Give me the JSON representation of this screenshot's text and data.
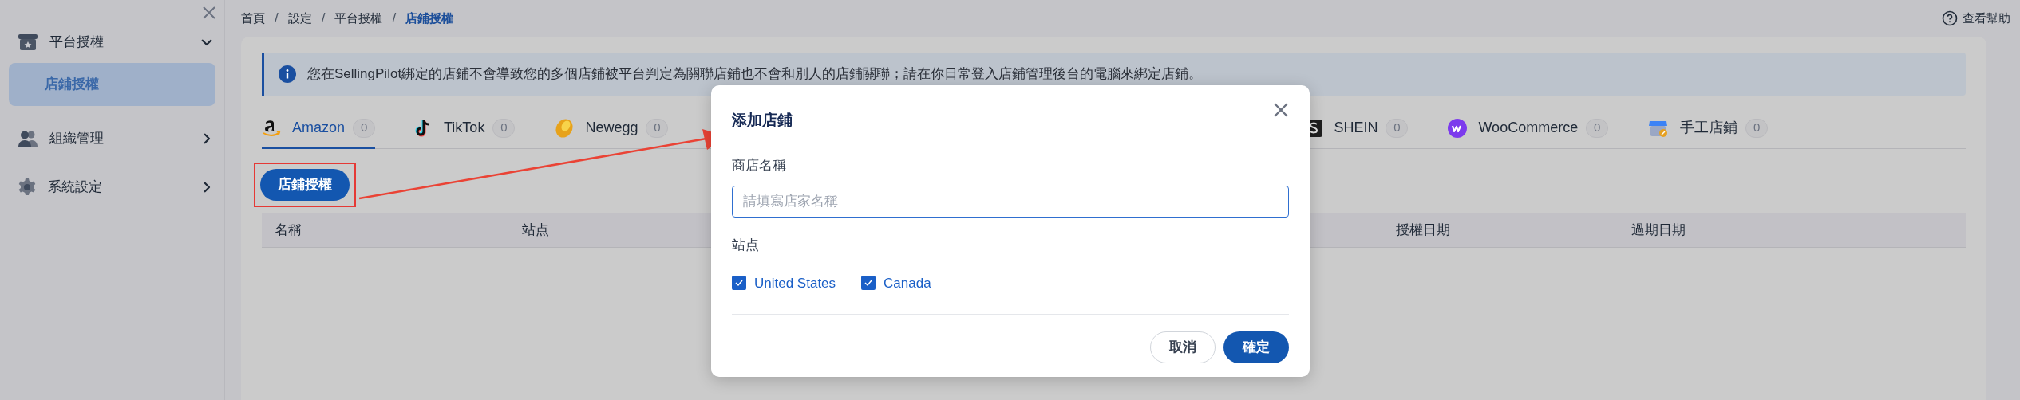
{
  "sidebar": {
    "items": [
      {
        "label": "平台授權",
        "kind": "store",
        "expanded": true,
        "children": [
          {
            "label": "店鋪授權",
            "selected": true
          }
        ]
      },
      {
        "label": "組織管理",
        "kind": "people",
        "expanded": false
      },
      {
        "label": "系統設定",
        "kind": "gear",
        "expanded": false
      }
    ]
  },
  "breadcrumb": [
    {
      "kind": "link",
      "label": "首頁",
      "selected": false
    },
    {
      "kind": "separator",
      "label": "/"
    },
    {
      "kind": "link",
      "label": "設定",
      "selected": false
    },
    {
      "kind": "separator",
      "label": "/"
    },
    {
      "kind": "link",
      "label": "平台授權",
      "selected": false
    },
    {
      "kind": "separator",
      "label": "/"
    },
    {
      "kind": "link",
      "label": "店鋪授權",
      "selected": true
    }
  ],
  "help_link": "查看幫助",
  "notice": "您在SellingPilot綁定的店鋪不會導致您的多個店鋪被平台判定為關聯店鋪也不會和別人的店鋪關聯；請在你日常登入店鋪管理後台的電腦來綁定店鋪。",
  "tabs": [
    {
      "label": "Amazon",
      "count": "0",
      "kind": "amazon",
      "selected": true
    },
    {
      "label": "TikTok",
      "count": "0",
      "kind": "tiktok",
      "selected": false
    },
    {
      "label": "Newegg",
      "count": "0",
      "kind": "egg",
      "selected": false
    },
    {
      "label": "SHEIN",
      "count": "0",
      "kind": "square",
      "selected": false
    },
    {
      "label": "WooCommerce",
      "count": "0",
      "kind": "woo",
      "selected": false
    },
    {
      "label": "手工店鋪",
      "count": "0",
      "kind": "shop",
      "selected": false
    }
  ],
  "authorize_button": "店鋪授權",
  "table": {
    "columns": [
      "名稱",
      "站点",
      "授權日期",
      "過期日期"
    ]
  },
  "dialog": {
    "title": "添加店鋪",
    "name_label": "商店名稱",
    "name_field": {
      "placeholder": "請填寫店家名稱"
    },
    "site_label": "站点",
    "sites": [
      {
        "label": "United States",
        "checked": true
      },
      {
        "label": "Canada",
        "checked": true
      }
    ],
    "buttons": [
      {
        "label": "取消",
        "kind": "secondary"
      },
      {
        "label": "確定",
        "kind": "primary"
      }
    ]
  }
}
